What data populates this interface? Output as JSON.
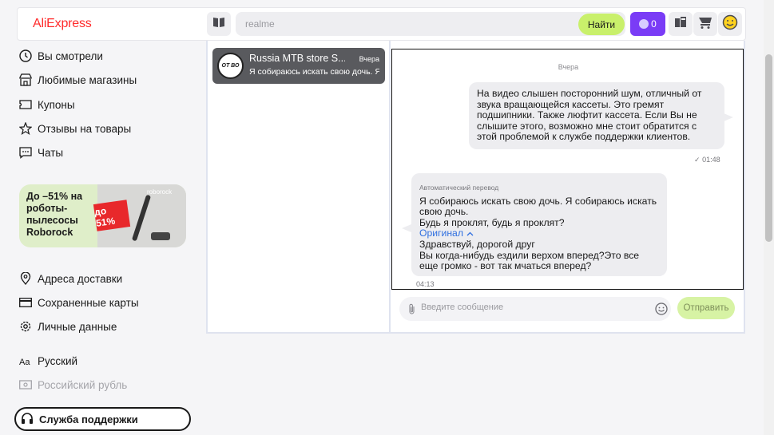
{
  "header": {
    "logo": "AliExpress",
    "search_placeholder": "realme",
    "search_button": "Найти",
    "coins_count": "0"
  },
  "sidebar": {
    "items": [
      {
        "label": "Вы смотрели",
        "icon": "clock-icon"
      },
      {
        "label": "Любимые магазины",
        "icon": "store-icon"
      },
      {
        "label": "Купоны",
        "icon": "coupon-icon"
      },
      {
        "label": "Отзывы на товары",
        "icon": "star-icon"
      },
      {
        "label": "Чаты",
        "icon": "chat-icon"
      }
    ],
    "promo": {
      "text": "До –51% на роботы-пылесосы Roborock",
      "badge": "до 51%",
      "brand": "roborock"
    },
    "items2": [
      {
        "label": "Адреса доставки",
        "icon": "location-pin-icon"
      },
      {
        "label": "Сохраненные карты",
        "icon": "card-icon"
      },
      {
        "label": "Личные данные",
        "icon": "gear-icon"
      }
    ],
    "language": "Русский",
    "currency": "Российский рубль",
    "support": "Служба поддержки"
  },
  "chat_list": {
    "items": [
      {
        "name": "Russia MTB store S...",
        "date": "Вчера",
        "preview": "Я собираюсь искать свою дочь. Я",
        "avatar_text": "ОТ ВО"
      }
    ]
  },
  "conversation": {
    "day_label": "Вчера",
    "outgoing": {
      "text": "На видео слышен посторонний шум, отличный от звука вращающейся кассеты. Это гремят подшипники. Также люфтит кассета. Если Вы не слышите этого, возможно   мне стоит обратится с этой проблемой к службе поддержки клиентов.",
      "time": "01:48",
      "status": "✓"
    },
    "incoming": {
      "auto_label": "Автоматический перевод",
      "translated": "Я собираюсь искать свою дочь. Я собираюсь искать свою дочь.\nБудь я проклят, будь я проклят?",
      "original_link": "Оригинал",
      "original": "Здравствуй, дорогой друг\nВы когда-нибудь ездили верхом вперед?Это все еще громко - вот так мчаться вперед?",
      "time": "04:13"
    },
    "composer_placeholder": "Введите сообщение",
    "send_button": "Отправить"
  },
  "colors": {
    "brand": "#ff2b2b",
    "search_button_bg": "#c9f06b",
    "coins_bg": "#7a3cf6",
    "link": "#2f6fe0"
  }
}
